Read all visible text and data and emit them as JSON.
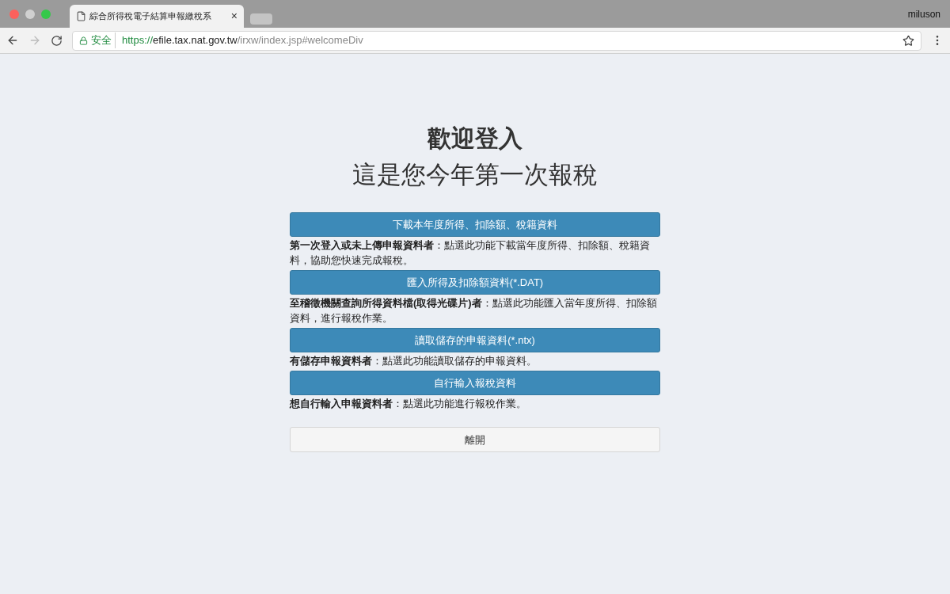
{
  "browser": {
    "tab": {
      "title": "綜合所得稅電子結算申報繳稅系",
      "close": "×"
    },
    "user": "miluson",
    "security_label": "安全",
    "url": {
      "scheme": "https://",
      "host": "efile.tax.nat.gov.tw",
      "path": "/irxw/index.jsp#welcomeDiv"
    }
  },
  "page": {
    "title": "歡迎登入",
    "subtitle": "這是您今年第一次報稅",
    "options": [
      {
        "button": "下載本年度所得、扣除額、稅籍資料",
        "description": "**第一次登入或未上傳申報資料者**：點選此功能下載當年度所得、扣除額、稅籍資料，協助您快速完成報稅。"
      },
      {
        "button": "匯入所得及扣除額資料(*.DAT)",
        "description": "**至稽徵機關查詢所得資料檔(取得光碟片)者**：點選此功能匯入當年度所得、扣除額資料，進行報稅作業。"
      },
      {
        "button": "讀取儲存的申報資料(*.ntx)",
        "description": "**有儲存申報資料者**：點選此功能讀取儲存的申報資料。"
      },
      {
        "button": "自行輸入報稅資料",
        "description": "**想自行輸入申報資料者**：點選此功能進行報稅作業。"
      }
    ],
    "leave_button": "離開"
  }
}
